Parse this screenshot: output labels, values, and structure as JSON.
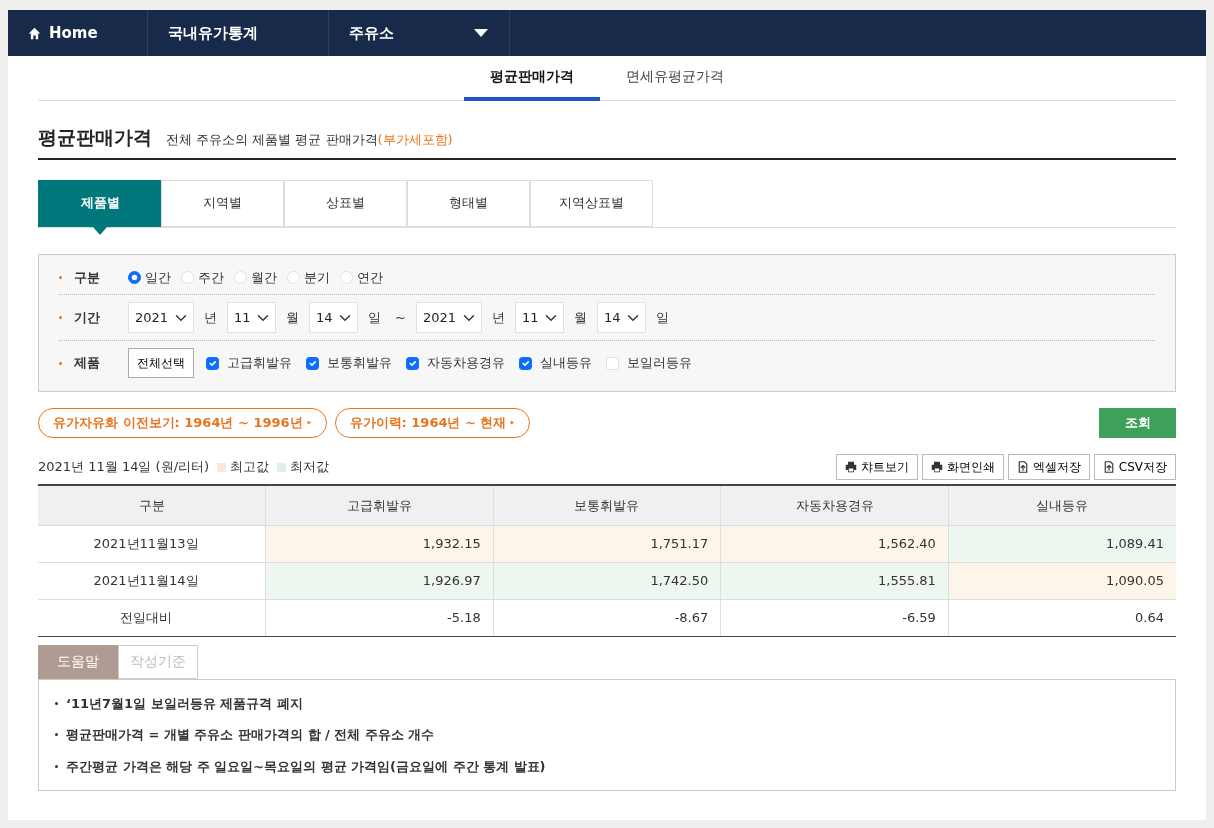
{
  "nav": [
    {
      "label": "Home",
      "kind": "home"
    },
    {
      "label": "국내유가통계",
      "kind": "plain"
    },
    {
      "label": "주유소",
      "kind": "dropdown"
    }
  ],
  "sub_tabs": [
    {
      "label": "평균판매가격",
      "selected": true
    },
    {
      "label": "면세유평균가격",
      "selected": false
    }
  ],
  "heading": {
    "title": "평균판매가격",
    "subtitle": "전체 주유소의 제품별 평균 판매가격",
    "subtitle_note": "(부가세포함)"
  },
  "tabs": [
    {
      "label": "제품별",
      "selected": true
    },
    {
      "label": "지역별",
      "selected": false
    },
    {
      "label": "상표별",
      "selected": false
    },
    {
      "label": "형태별",
      "selected": false
    },
    {
      "label": "지역상표별",
      "selected": false
    }
  ],
  "filters": {
    "period_type": {
      "label": "구분",
      "options": [
        {
          "label": "일간",
          "selected": true
        },
        {
          "label": "주간",
          "selected": false
        },
        {
          "label": "월간",
          "selected": false
        },
        {
          "label": "분기",
          "selected": false
        },
        {
          "label": "연간",
          "selected": false
        }
      ]
    },
    "date_range": {
      "label": "기간",
      "parts": [
        {
          "kind": "select",
          "value": "2021"
        },
        {
          "kind": "text",
          "value": "년"
        },
        {
          "kind": "select",
          "value": "11"
        },
        {
          "kind": "text",
          "value": "월"
        },
        {
          "kind": "select",
          "value": "14"
        },
        {
          "kind": "text",
          "value": "일"
        },
        {
          "kind": "text",
          "value": "~"
        },
        {
          "kind": "select",
          "value": "2021"
        },
        {
          "kind": "text",
          "value": "년"
        },
        {
          "kind": "select",
          "value": "11"
        },
        {
          "kind": "text",
          "value": "월"
        },
        {
          "kind": "select",
          "value": "14"
        },
        {
          "kind": "text",
          "value": "일"
        }
      ]
    },
    "products": {
      "label": "제품",
      "select_all": "전체선택",
      "options": [
        {
          "label": "고급휘발유",
          "checked": true
        },
        {
          "label": "보통휘발유",
          "checked": true
        },
        {
          "label": "자동차용경유",
          "checked": true
        },
        {
          "label": "실내등유",
          "checked": true
        },
        {
          "label": "보일러등유",
          "checked": false
        }
      ]
    }
  },
  "history_links": [
    "유가자유화 이전보기: 1964년 ~ 1996년",
    "유가이력: 1964년 ~ 현재"
  ],
  "search_button": "조회",
  "table_caption": "2021년 11월 14일 (원/리터)",
  "legend": [
    {
      "label": "최고값",
      "color": "#fbe7d8"
    },
    {
      "label": "최저값",
      "color": "#e2eee8"
    }
  ],
  "actions": [
    {
      "label": "챠트보기",
      "kind": "print"
    },
    {
      "label": "화면인쇄",
      "kind": "print"
    },
    {
      "label": "엑셀저장",
      "kind": "save"
    },
    {
      "label": "CSV저장",
      "kind": "save"
    }
  ],
  "table": {
    "columns": [
      "구분",
      "고급휘발유",
      "보통휘발유",
      "자동차용경유",
      "실내등유"
    ],
    "rows": [
      {
        "cells": [
          {
            "value": "2021년11월13일",
            "kind": "label"
          },
          {
            "value": "1,932.15",
            "kind": "max"
          },
          {
            "value": "1,751.17",
            "kind": "max"
          },
          {
            "value": "1,562.40",
            "kind": "max"
          },
          {
            "value": "1,089.41",
            "kind": "min"
          }
        ]
      },
      {
        "cells": [
          {
            "value": "2021년11월14일",
            "kind": "label"
          },
          {
            "value": "1,926.97",
            "kind": "min"
          },
          {
            "value": "1,742.50",
            "kind": "min"
          },
          {
            "value": "1,555.81",
            "kind": "min"
          },
          {
            "value": "1,090.05",
            "kind": "max"
          }
        ]
      },
      {
        "cells": [
          {
            "value": "전일대비",
            "kind": "label"
          },
          {
            "value": "-5.18",
            "kind": "plain"
          },
          {
            "value": "-8.67",
            "kind": "plain"
          },
          {
            "value": "-6.59",
            "kind": "plain"
          },
          {
            "value": "0.64",
            "kind": "plain"
          }
        ]
      }
    ]
  },
  "help_tabs": [
    {
      "label": "도움말",
      "selected": true
    },
    {
      "label": "작성기준",
      "selected": false
    }
  ],
  "help_items": [
    "‘11년7월1일 보일러등유 제품규격 폐지",
    "평균판매가격 = 개별 주유소 판매가격의 합 / 전체 주유소 개수",
    "주간평균 가격은 해당 주 일요일~목요일의 평균 가격임(금요일에 주간 통계 발표)"
  ]
}
